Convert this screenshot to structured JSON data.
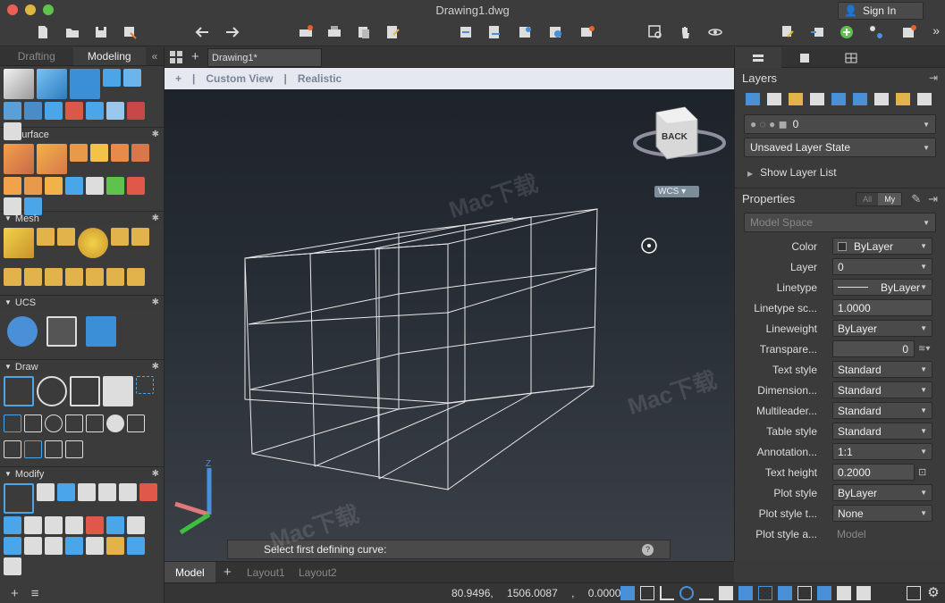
{
  "window": {
    "title": "Drawing1.dwg",
    "signin": "Sign In"
  },
  "left_panel": {
    "tabs": [
      "Drafting",
      "Modeling"
    ],
    "sections": [
      {
        "label": "Surface"
      },
      {
        "label": "Mesh"
      },
      {
        "label": "UCS"
      },
      {
        "label": "Draw"
      },
      {
        "label": "Modify"
      }
    ]
  },
  "doc": {
    "tab": "Drawing1*"
  },
  "viewport": {
    "plus": "+",
    "view": "Custom View",
    "style": "Realistic",
    "viewcube": "BACK",
    "wcs": "WCS",
    "prompt": "Select first defining curve:",
    "help": "?"
  },
  "layout_tabs": [
    "Model",
    "Layout1",
    "Layout2"
  ],
  "status": {
    "coords": "80.9496, 1506.0087 , 0.0000"
  },
  "right_panel": {
    "layers_title": "Layers",
    "current_layer": "0",
    "layer_state": "Unsaved Layer State",
    "show_list": "Show Layer List",
    "properties_title": "Properties",
    "filter": [
      "All",
      "My"
    ],
    "space": "Model Space",
    "props": [
      {
        "label": "Color",
        "value": "ByLayer"
      },
      {
        "label": "Layer",
        "value": "0"
      },
      {
        "label": "Linetype",
        "value": "ByLayer"
      },
      {
        "label": "Linetype sc...",
        "value": "1.0000"
      },
      {
        "label": "Lineweight",
        "value": "ByLayer"
      },
      {
        "label": "Transpare...",
        "value": "0"
      },
      {
        "label": "Text style",
        "value": "Standard"
      },
      {
        "label": "Dimension...",
        "value": "Standard"
      },
      {
        "label": "Multileader...",
        "value": "Standard"
      },
      {
        "label": "Table style",
        "value": "Standard"
      },
      {
        "label": "Annotation...",
        "value": "1:1"
      },
      {
        "label": "Text height",
        "value": "0.2000"
      },
      {
        "label": "Plot style",
        "value": "ByLayer"
      },
      {
        "label": "Plot style t...",
        "value": "None"
      },
      {
        "label": "Plot style a...",
        "value": "Model"
      }
    ]
  },
  "watermarks": [
    "Mac下载"
  ],
  "colors": {
    "accent": "#4a90d9",
    "cube_blue": "#4aa6e8",
    "cube_gold": "#e2b34a"
  }
}
